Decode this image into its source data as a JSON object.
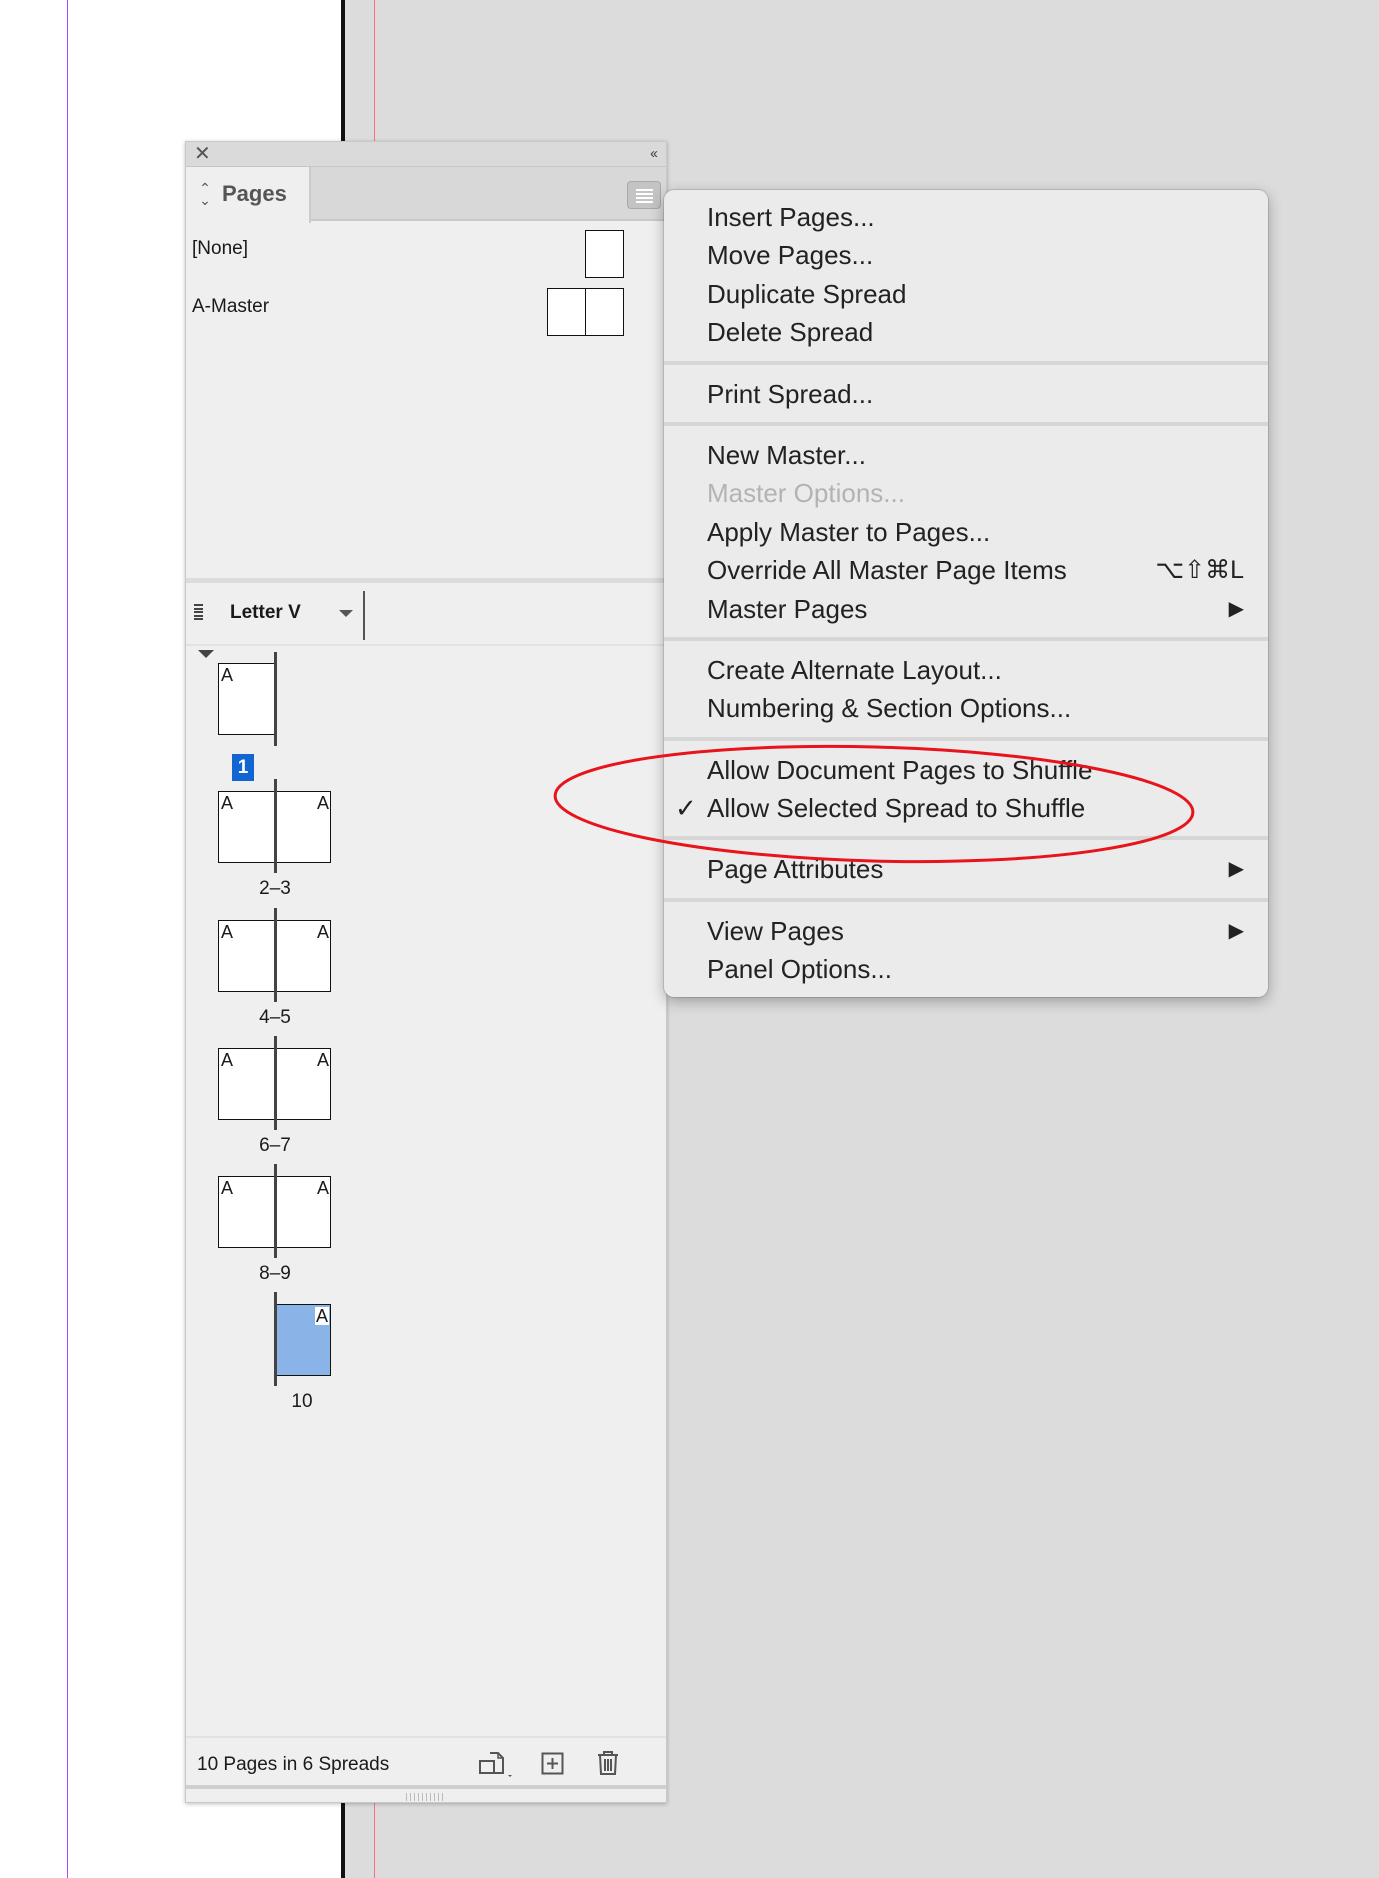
{
  "panel": {
    "close_icon": "close-icon",
    "collapse_label": "‹‹",
    "tab_label": "Pages",
    "masters": [
      {
        "name": "[None]"
      },
      {
        "name": "A-Master"
      }
    ],
    "page_size": "Letter V",
    "spreads": [
      {
        "label": "1",
        "type": "single-right",
        "selected_label": true,
        "masters": [
          "A"
        ]
      },
      {
        "label": "2–3",
        "type": "spread",
        "masters": [
          "A",
          "A"
        ]
      },
      {
        "label": "4–5",
        "type": "spread",
        "masters": [
          "A",
          "A"
        ]
      },
      {
        "label": "6–7",
        "type": "spread",
        "masters": [
          "A",
          "A"
        ]
      },
      {
        "label": "8–9",
        "type": "spread",
        "masters": [
          "A",
          "A"
        ]
      },
      {
        "label": "10",
        "type": "single-left",
        "selected": true,
        "masters": [
          "A"
        ]
      }
    ],
    "footer_text": "10 Pages in 6 Spreads"
  },
  "menu": {
    "groups": [
      [
        {
          "label": "Insert Pages..."
        },
        {
          "label": "Move Pages..."
        },
        {
          "label": "Duplicate Spread"
        },
        {
          "label": "Delete Spread"
        }
      ],
      [
        {
          "label": "Print Spread..."
        }
      ],
      [
        {
          "label": "New Master..."
        },
        {
          "label": "Master Options...",
          "disabled": true
        },
        {
          "label": "Apply Master to Pages..."
        },
        {
          "label": "Override All Master Page Items",
          "shortcut": "⌥⇧⌘L"
        },
        {
          "label": "Master Pages",
          "submenu": true
        }
      ],
      [
        {
          "label": "Create Alternate Layout..."
        },
        {
          "label": "Numbering & Section Options..."
        }
      ],
      [
        {
          "label": "Allow Document Pages to Shuffle"
        },
        {
          "label": "Allow Selected Spread to Shuffle",
          "checked": true
        }
      ],
      [
        {
          "label": "Page Attributes",
          "submenu": true
        }
      ],
      [
        {
          "label": "View Pages",
          "submenu": true
        },
        {
          "label": "Panel Options..."
        }
      ]
    ]
  },
  "colors": {
    "selection": "#1266d4",
    "selected_page": "#8ab4e8",
    "annotation": "#e8141c"
  }
}
